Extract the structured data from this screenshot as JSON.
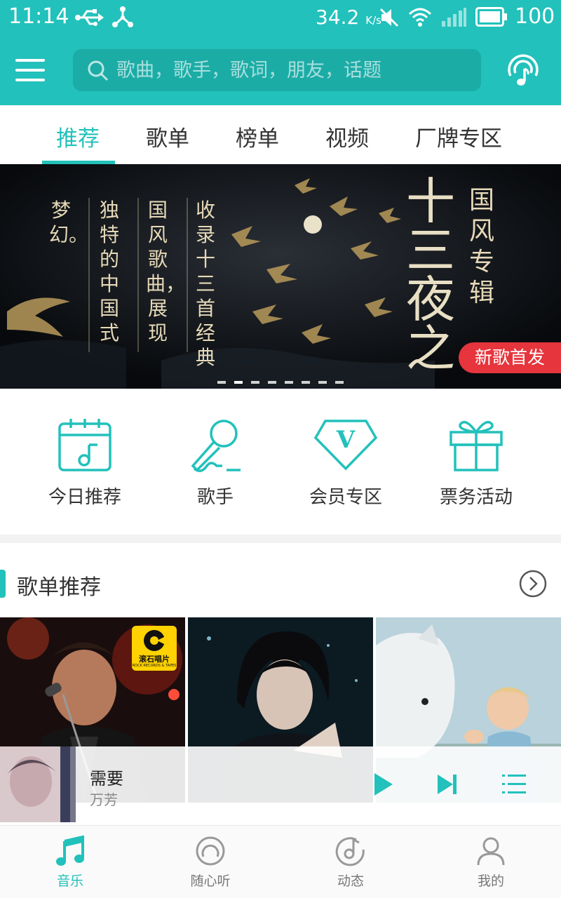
{
  "status_bar": {
    "time": "11:14",
    "net_speed": "34.2",
    "net_speed_unit": "K/s",
    "battery": "100"
  },
  "header": {
    "search_placeholder": "歌曲，歌手，歌词，朋友，话题",
    "accent_color": "#22c1bb"
  },
  "tabs": [
    {
      "label": "推荐",
      "active": true
    },
    {
      "label": "歌单",
      "active": false
    },
    {
      "label": "榜单",
      "active": false
    },
    {
      "label": "视频",
      "active": false
    },
    {
      "label": "厂牌专区",
      "active": false
    }
  ],
  "banner": {
    "big_title": "十三夜之",
    "side_title": "国风专辑",
    "columns": [
      "收录十三首经典",
      "国风歌曲，展现",
      "独特的中国式",
      "梦幻。"
    ],
    "badge": "新歌首发",
    "slide_count": 8,
    "active_slide": 1
  },
  "quick_menu": [
    {
      "label": "今日推荐",
      "icon": "calendar-music-icon"
    },
    {
      "label": "歌手",
      "icon": "microphone-icon"
    },
    {
      "label": "会员专区",
      "icon": "vip-diamond-icon"
    },
    {
      "label": "票务活动",
      "icon": "gift-icon"
    }
  ],
  "section": {
    "title": "歌单推荐"
  },
  "playlists": [
    {
      "caption": "",
      "badge": "滚石唱片",
      "badge_sub": "ROCK RECORDS & TAPES"
    },
    {
      "caption": ""
    },
    {
      "caption": ""
    }
  ],
  "now_playing": {
    "title": "需要",
    "artist": "万芳"
  },
  "bottom_nav": [
    {
      "label": "音乐",
      "icon": "music-note-icon",
      "active": true
    },
    {
      "label": "随心听",
      "icon": "radio-icon",
      "active": false
    },
    {
      "label": "动态",
      "icon": "disc-note-icon",
      "active": false
    },
    {
      "label": "我的",
      "icon": "user-icon",
      "active": false
    }
  ]
}
